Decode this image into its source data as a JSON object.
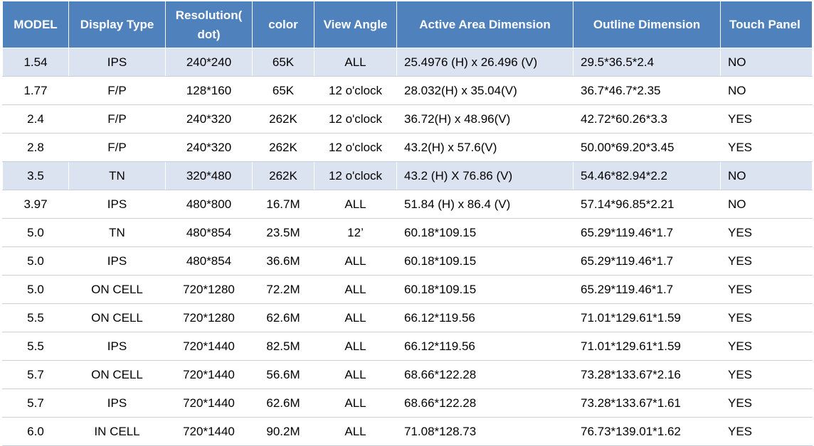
{
  "table": {
    "headers": [
      "MODEL",
      "Display Type",
      "Resolution( dot)",
      "color",
      "View Angle",
      "Active Area Dimension",
      "Outline Dimension",
      "Touch Panel"
    ],
    "header_color": "#4f81bd",
    "highlight_color": "#dce3f0",
    "rows": [
      [
        "1.54",
        "IPS",
        "240*240",
        "65K",
        "ALL",
        "25.4976 (H) x 26.496 (V)",
        "29.5*36.5*2.4",
        "NO"
      ],
      [
        "1.77",
        "F/P",
        "128*160",
        "65K",
        "12 o'clock",
        "28.032(H) x 35.04(V)",
        "36.7*46.7*2.35",
        "NO"
      ],
      [
        "2.4",
        "F/P",
        "240*320",
        "262K",
        "12 o'clock",
        "36.72(H) x 48.96(V)",
        "42.72*60.26*3.3",
        "YES"
      ],
      [
        "2.8",
        "F/P",
        "240*320",
        "262K",
        "12 o'clock",
        "43.2(H) x 57.6(V)",
        "50.00*69.20*3.45",
        "YES"
      ],
      [
        "3.5",
        "TN",
        "320*480",
        "262K",
        "12 o'clock",
        "43.2 (H) X 76.86 (V)",
        "54.46*82.94*2.2",
        "NO"
      ],
      [
        "3.97",
        "IPS",
        "480*800",
        "16.7M",
        "ALL",
        "51.84 (H) x 86.4 (V)",
        "57.14*96.85*2.21",
        "NO"
      ],
      [
        "5.0",
        "TN",
        "480*854",
        "23.5M",
        "12’",
        "60.18*109.15",
        "65.29*119.46*1.7",
        "YES"
      ],
      [
        "5.0",
        "IPS",
        "480*854",
        "36.6M",
        "ALL",
        "60.18*109.15",
        "65.29*119.46*1.7",
        "YES"
      ],
      [
        "5.0",
        "ON CELL",
        "720*1280",
        "72.2M",
        "ALL",
        "60.18*109.15",
        "65.29*119.46*1.7",
        "YES"
      ],
      [
        "5.5",
        "ON CELL",
        "720*1280",
        "62.6M",
        "ALL",
        "66.12*119.56",
        "71.01*129.61*1.59",
        "YES"
      ],
      [
        "5.5",
        "IPS",
        "720*1440",
        "82.5M",
        "ALL",
        "66.12*119.56",
        "71.01*129.61*1.59",
        "YES"
      ],
      [
        "5.7",
        "ON CELL",
        "720*1440",
        "56.6M",
        "ALL",
        "68.66*122.28",
        "73.28*133.67*2.16",
        "YES"
      ],
      [
        "5.7",
        "IPS",
        "720*1440",
        "62.6M",
        "ALL",
        "68.66*122.28",
        "73.28*133.67*1.61",
        "YES"
      ],
      [
        "6.0",
        "IN CELL",
        "720*1440",
        "90.2M",
        "ALL",
        "71.08*128.73",
        "76.73*139.01*1.62",
        "YES"
      ]
    ],
    "highlighted_rows": [
      0,
      4
    ]
  }
}
